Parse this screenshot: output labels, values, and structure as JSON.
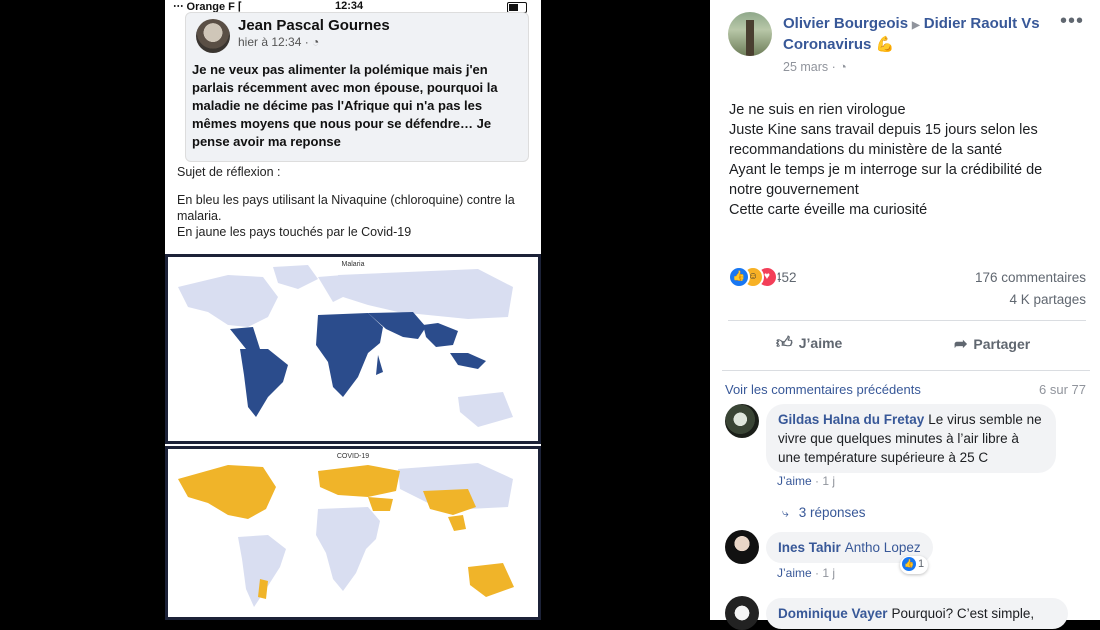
{
  "screenshot": {
    "status_bar": {
      "carrier": "‧‧‧ Orange F ⌈",
      "time": "12:34"
    },
    "embedded_post": {
      "author": "Jean Pascal Gournes",
      "meta": "hier à 12:34 · ◔",
      "text": "Je ne veux pas alimenter la polémique mais j'en parlais récemment avec mon épouse,  pourquoi la maladie ne décime pas l'Afrique qui n'a pas les mêmes moyens que nous pour se défendre… Je pense avoir ma reponse"
    },
    "note_title": "Sujet de réflexion :",
    "note_line1": "En bleu les pays utilisant la Nivaquine (chloroquine) contre la malaria.",
    "note_line2": "En jaune les pays touchés par le Covid-19",
    "map1_title": "Malaria",
    "map2_title": "COVID-19",
    "map1_color": "#2b4c8c",
    "map2_color": "#f0b429",
    "land_color": "#d9def1"
  },
  "post": {
    "author": "Olivier Bourgeois",
    "group": "Didier Raoult Vs Coronavirus 💪",
    "date": "25 mars · ◔",
    "more": "•••",
    "text_lines": [
      "Je ne suis en rien virologue",
      "Juste Kine sans travail depuis 15 jours selon les recommandations du ministère de la santé",
      "Ayant le temps je m interroge sur la crédibilité de notre gouvernement",
      "Cette carte éveille ma curiosité"
    ],
    "reaction_count": "452",
    "comments_count": "176 commentaires",
    "shares_count": "4 K partages",
    "like_label": "J’aime",
    "share_label": "Partager"
  },
  "comments_section": {
    "previous_link": "Voir les commentaires précédents",
    "range": "6 sur 77",
    "comments": [
      {
        "author": "Gildas Halna du Fretay",
        "text": "Le virus semble ne vivre que quelques minutes à l’air libre à une température supérieure à 25 C",
        "like": "J’aime",
        "time": "1 j",
        "replies": "3 réponses"
      },
      {
        "author": "Ines Tahir",
        "tag": "Antho Lopez",
        "like": "J’aime",
        "time": "1 j",
        "reaction_count": "1"
      },
      {
        "author": "Dominique Vayer",
        "text": "Pourquoi? C’est simple,"
      }
    ]
  },
  "colors": {
    "link": "#385898",
    "secondary": "#90949c",
    "like_blue": "#1877f2"
  }
}
